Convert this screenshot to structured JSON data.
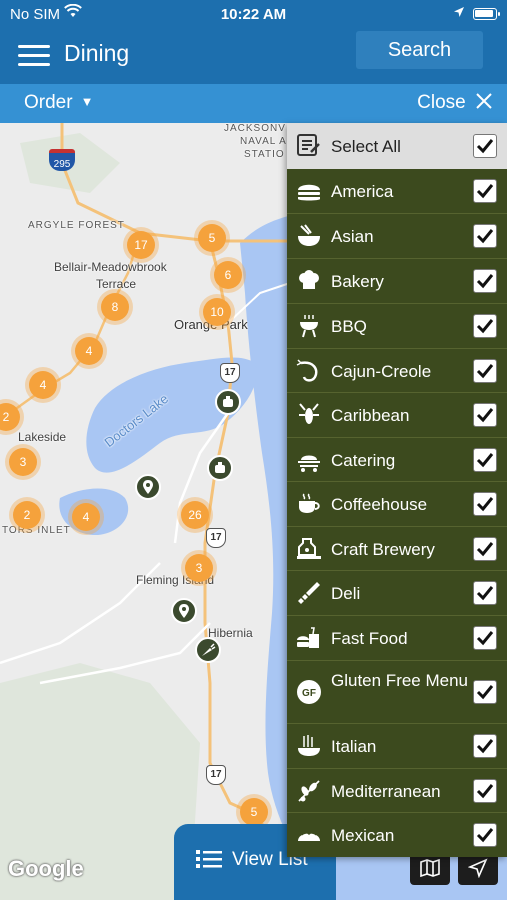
{
  "status_bar": {
    "carrier": "No SIM",
    "time": "10:22 AM"
  },
  "header": {
    "title": "Dining",
    "search_label": "Search"
  },
  "toolbar": {
    "order_label": "Order",
    "close_label": "Close"
  },
  "map": {
    "labels": {
      "jacksonville": "JACKSONV",
      "naval_air": "NAVAL A",
      "station": "STATIO",
      "argyle_forest": "ARGYLE FOREST",
      "bellair": "Bellair-Meadowbrook",
      "terrace": "Terrace",
      "orange_park": "Orange Park",
      "doctors_lake": "Doctors Lake",
      "lakeside": "Lakeside",
      "doctors_inlet": "TORS INLET",
      "fleming_island": "Fleming Island",
      "hibernia": "Hibernia"
    },
    "clusters": [
      "17",
      "5",
      "6",
      "8",
      "10",
      "4",
      "4",
      "2",
      "3",
      "2",
      "4",
      "26",
      "3",
      "5"
    ],
    "route_shields": [
      "17",
      "17",
      "17"
    ],
    "interstate_shield": "295",
    "attribution": "Google"
  },
  "view_list_label": "View List",
  "filters": {
    "select_all": "Select All",
    "items": [
      {
        "label": "America",
        "icon": "burger-icon",
        "checked": true
      },
      {
        "label": "Asian",
        "icon": "bowl-chopsticks-icon",
        "checked": true
      },
      {
        "label": "Bakery",
        "icon": "chef-hat-icon",
        "checked": true
      },
      {
        "label": "BBQ",
        "icon": "grill-icon",
        "checked": true
      },
      {
        "label": "Cajun-Creole",
        "icon": "shrimp-icon",
        "checked": true
      },
      {
        "label": "Caribbean",
        "icon": "lobster-icon",
        "checked": true
      },
      {
        "label": "Catering",
        "icon": "serving-cart-icon",
        "checked": true
      },
      {
        "label": "Coffeehouse",
        "icon": "coffee-cup-icon",
        "checked": true
      },
      {
        "label": "Craft Brewery",
        "icon": "brewery-tank-icon",
        "checked": true
      },
      {
        "label": "Deli",
        "icon": "sandwich-icon",
        "checked": true
      },
      {
        "label": "Fast Food",
        "icon": "fast-food-icon",
        "checked": true
      },
      {
        "label": "Gluten Free Menu",
        "icon": "gf-icon",
        "checked": true
      },
      {
        "label": "Italian",
        "icon": "pasta-icon",
        "checked": true
      },
      {
        "label": "Mediterranean",
        "icon": "olive-branch-icon",
        "checked": true
      },
      {
        "label": "Mexican",
        "icon": "taco-icon",
        "checked": true
      }
    ]
  },
  "colors": {
    "header_blue": "#1d6fae",
    "toolbar_blue": "#3591d3",
    "panel_green": "#3c4a1e",
    "cluster_orange": "#f5a23c"
  }
}
